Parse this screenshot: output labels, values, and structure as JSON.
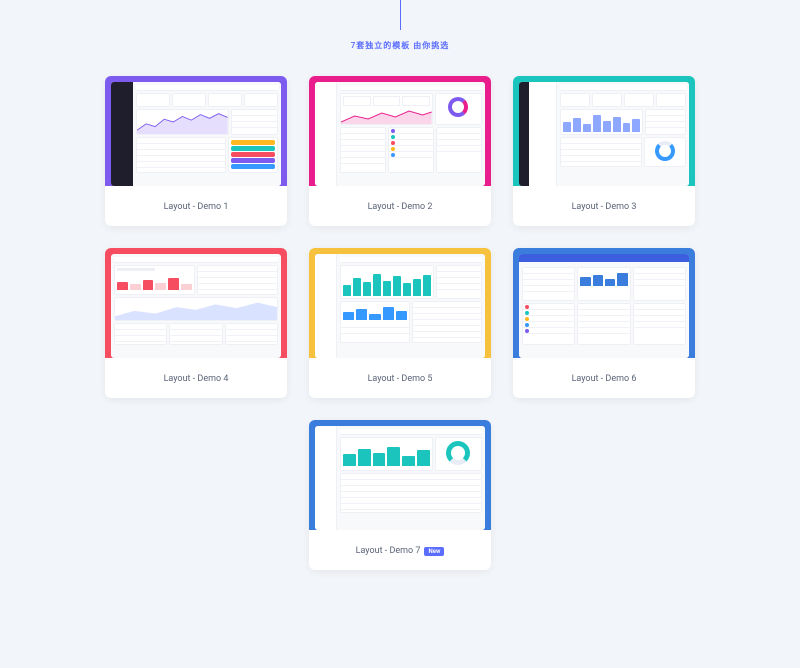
{
  "tagline": "7套独立的模板 由你挑选",
  "demos": [
    {
      "label": "Layout - Demo 1",
      "frame_color": "#7e5bef",
      "has_badge": false,
      "style": {
        "sidebar": "dark",
        "accent": "#7e5bef",
        "chart": "area"
      }
    },
    {
      "label": "Layout - Demo 2",
      "frame_color": "#e91e8c",
      "has_badge": false,
      "style": {
        "sidebar": "light",
        "accent": "#e91e8c",
        "chart": "area"
      }
    },
    {
      "label": "Layout - Demo 3",
      "frame_color": "#1bc5bd",
      "has_badge": false,
      "style": {
        "sidebar": "slim",
        "accent": "#1bc5bd",
        "chart": "bars"
      }
    },
    {
      "label": "Layout - Demo 4",
      "frame_color": "#f64e60",
      "has_badge": false,
      "style": {
        "sidebar": "none",
        "accent": "#f64e60",
        "chart": "area"
      }
    },
    {
      "label": "Layout - Demo 5",
      "frame_color": "#f6c23e",
      "has_badge": false,
      "style": {
        "sidebar": "light",
        "accent": "#1bc5bd",
        "chart": "bars"
      }
    },
    {
      "label": "Layout - Demo 6",
      "frame_color": "#3b7ddd",
      "has_badge": false,
      "style": {
        "sidebar": "none",
        "accent": "#3b7ddd",
        "chart": "mixed",
        "header": "blue"
      }
    },
    {
      "label": "Layout - Demo 7",
      "frame_color": "#3b7ddd",
      "has_badge": true,
      "badge_label": "New",
      "style": {
        "sidebar": "light",
        "accent": "#1bc5bd",
        "chart": "donut"
      }
    }
  ],
  "colors": {
    "page_bg": "#f2f5f9",
    "text_muted": "#5a6377",
    "primary": "#5b6dff"
  }
}
